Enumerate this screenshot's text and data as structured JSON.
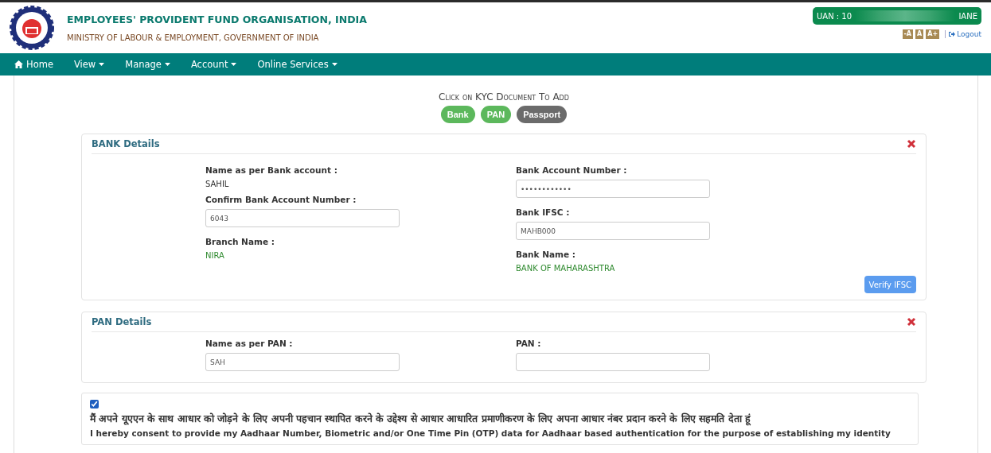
{
  "header": {
    "title": "EMPLOYEES' PROVIDENT FUND ORGANISATION, INDIA",
    "subtitle": "MINISTRY OF LABOUR & EMPLOYMENT, GOVERNMENT OF INDIA",
    "uan": "UAN : 10",
    "uan_end": "IANE",
    "font_buttons": [
      "-A",
      "A",
      "A+"
    ],
    "logout": "Logout"
  },
  "nav": [
    {
      "label": "Home",
      "kind": "home"
    },
    {
      "label": "View",
      "kind": "menu"
    },
    {
      "label": "Manage",
      "kind": "menu"
    },
    {
      "label": "Account",
      "kind": "menu"
    },
    {
      "label": "Online Services",
      "kind": "menu"
    }
  ],
  "kyc_prompt": "Click on KYC Document To Add",
  "documents": [
    {
      "label": "Bank",
      "selected": true
    },
    {
      "label": "PAN",
      "selected": true
    },
    {
      "label": "Passport",
      "selected": false
    }
  ],
  "bank": {
    "title": "BANK Details",
    "left": [
      {
        "label": "Name as per Bank account :",
        "kind": "text",
        "value": "SAHIL"
      },
      {
        "label": "Confirm Bank Account Number :",
        "kind": "input",
        "value": "6043"
      },
      {
        "label": "Branch Name :",
        "kind": "result",
        "value": "NIRA"
      }
    ],
    "right": [
      {
        "label": "Bank Account Number :",
        "kind": "input",
        "value": "••••••••••••"
      },
      {
        "label": "Bank IFSC :",
        "kind": "input",
        "value": "MAHB000"
      },
      {
        "label": "Bank Name :",
        "kind": "result",
        "value": "BANK OF MAHARASHTRA"
      }
    ],
    "verify": "Verify IFSC"
  },
  "pan": {
    "title": "PAN Details",
    "left": [
      {
        "label": "Name as per PAN :",
        "kind": "input",
        "value": "SAH"
      }
    ],
    "right": [
      {
        "label": "PAN :",
        "kind": "input"
      }
    ]
  },
  "consent": {
    "checked": true,
    "hindi": "मैं अपने यूएएन के साथ आधार को जोड़ने के लिए अपनी पहचान स्थापित करने के उद्देश्य से आधार आधारित प्रमाणीकरण के लिए अपना आधार नंबर प्रदान करने के लिए सहमति देता हूं",
    "english": "I hereby consent to provide my Aadhaar Number, Biometric and/or One Time Pin (OTP) data for Aadhaar based authentication for the purpose of establishing my identity"
  }
}
